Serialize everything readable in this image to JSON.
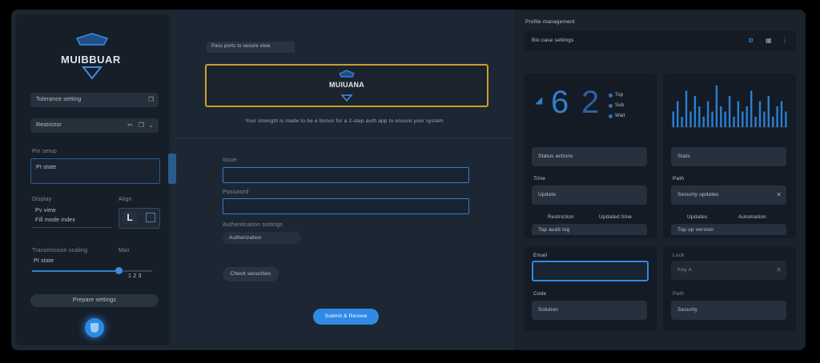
{
  "left_panel": {
    "logo_text": "MUIBBUAR",
    "select1_value": "Tolerance setting",
    "select2_value": "Restrictor",
    "section_label": "Pin setup",
    "textarea_value": "Pt state",
    "col1_label": "Display",
    "col1_value1": "Pv view",
    "col1_value2": "Fill mode index",
    "col2_label": "Align",
    "col2_value": "L",
    "slider_label": "Transmission scaling",
    "slider_label2": "Max",
    "slider_value": "Pt state",
    "slider_end_value": "1 2 3",
    "bottom_button": "Prepare settings",
    "fab_icon": "shield-icon"
  },
  "center_panel": {
    "badge": "Pass ports to secure view",
    "banner_logo_text": "MUIUANA",
    "caption": "Your strength is made to be a bonus for a 2-step auth app to ensure your system",
    "field1_label": "Issue",
    "field1_value": "",
    "field2_label": "Password",
    "field2_value": "",
    "dropdown_label": "Authentication settings",
    "dropdown_value": "Authorization",
    "secondary_button": "Check securities",
    "primary_button": "Submit & Review"
  },
  "right_panel": {
    "header_title": "Profile management",
    "search_value": "Bio case settings",
    "widget1": {
      "digit_left": "6",
      "digit_right": "2",
      "legend": [
        "Top",
        "Sub",
        "Wait"
      ],
      "field1": "Status actions",
      "label2": "Time",
      "field2": "Update",
      "col_a": "Restriction",
      "col_b": "Updated time",
      "field3": "Top audit log"
    },
    "widget2": {
      "bar_values": [
        3,
        5,
        2,
        7,
        3,
        6,
        4,
        2,
        5,
        3,
        8,
        4,
        3,
        6,
        2,
        5,
        3,
        4,
        7,
        2,
        5,
        3,
        6,
        2,
        4,
        5,
        3
      ],
      "field1": "Stats",
      "label2": "Path",
      "field2": "Security updates",
      "col_a": "Updates",
      "col_b": "Automation",
      "field3": "Top up version"
    },
    "widget3": {
      "label1": "Email",
      "input_value": "",
      "label2": "Code",
      "field2": "Solution"
    },
    "widget4": {
      "label1": "Lock",
      "field1": "Key A",
      "label2": "Path",
      "field2": "Security"
    }
  },
  "colors": {
    "accent_blue": "#2f7fd0",
    "gold": "#c9a12a",
    "bar_blue": "#2a7fd4"
  }
}
